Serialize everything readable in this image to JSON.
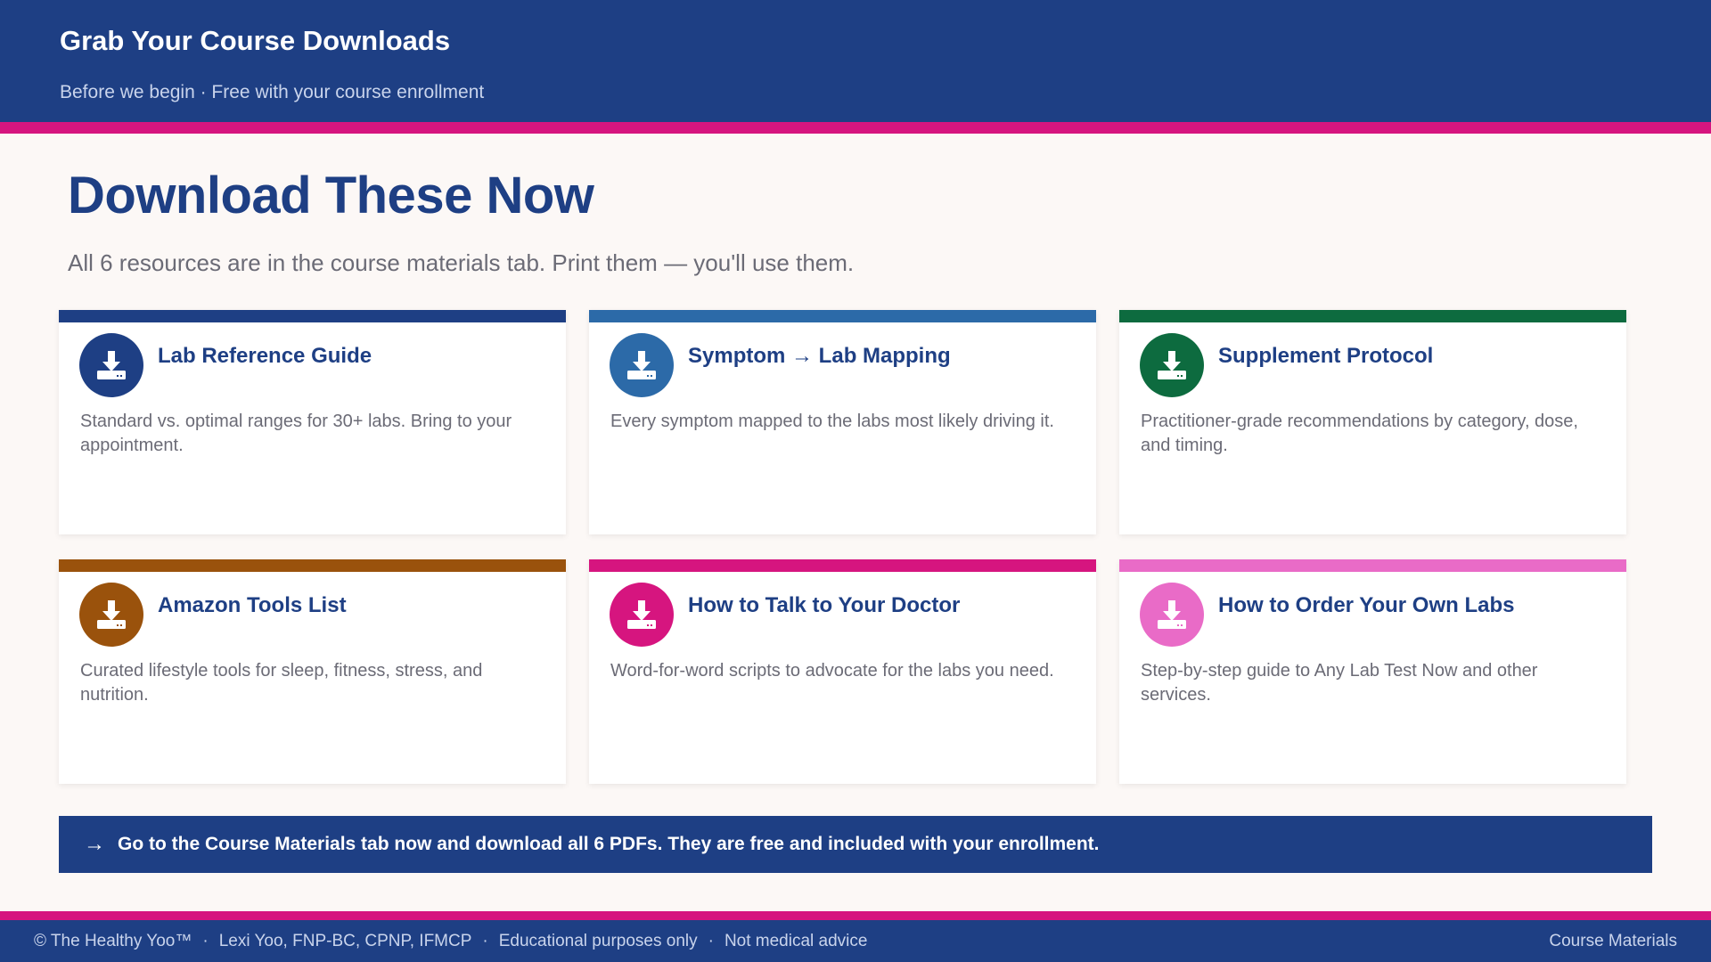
{
  "header": {
    "title": "Grab Your Course Downloads",
    "subtitle": "Before we begin · Free with your course enrollment"
  },
  "main": {
    "title": "Download These Now",
    "subtitle": "All 6 resources are in the course materials tab. Print them — you'll use them."
  },
  "cards": [
    {
      "title": "Lab Reference Guide",
      "description": "Standard vs. optimal ranges for 30+ labs. Bring to your appointment.",
      "color": "#1e3f84",
      "icon": "download-icon"
    },
    {
      "title": "Symptom → Lab Mapping",
      "description": "Every symptom mapped to the labs most likely driving it.",
      "color": "#2c6aa8",
      "icon": "download-icon"
    },
    {
      "title": "Supplement Protocol",
      "description": "Practitioner-grade recommendations by category, dose, and timing.",
      "color": "#0d6b3f",
      "icon": "download-icon"
    },
    {
      "title": "Amazon Tools List",
      "description": "Curated lifestyle tools for sleep, fitness, stress, and nutrition.",
      "color": "#9a520c",
      "icon": "download-icon"
    },
    {
      "title": "How to Talk to Your Doctor",
      "description": "Word-for-word scripts to advocate for the labs you need.",
      "color": "#d6157f",
      "icon": "download-icon"
    },
    {
      "title": "How to Order Your Own Labs",
      "description": "Step-by-step guide to Any Lab Test Now and other services.",
      "color": "#e96bc7",
      "icon": "download-icon"
    }
  ],
  "cta": {
    "arrow": "→",
    "text": "Go to the Course Materials tab now and download all 6 PDFs. They are free and included with your enrollment."
  },
  "footer": {
    "items": [
      "© The Healthy Yoo™",
      "Lexi Yoo, FNP-BC, CPNP, IFMCP",
      "Educational purposes only",
      "Not medical advice"
    ],
    "separator": "·",
    "right": "Course Materials"
  },
  "colors": {
    "brand_navy": "#1e3f84",
    "accent_magenta": "#d6157f",
    "background": "#fcf8f6"
  }
}
